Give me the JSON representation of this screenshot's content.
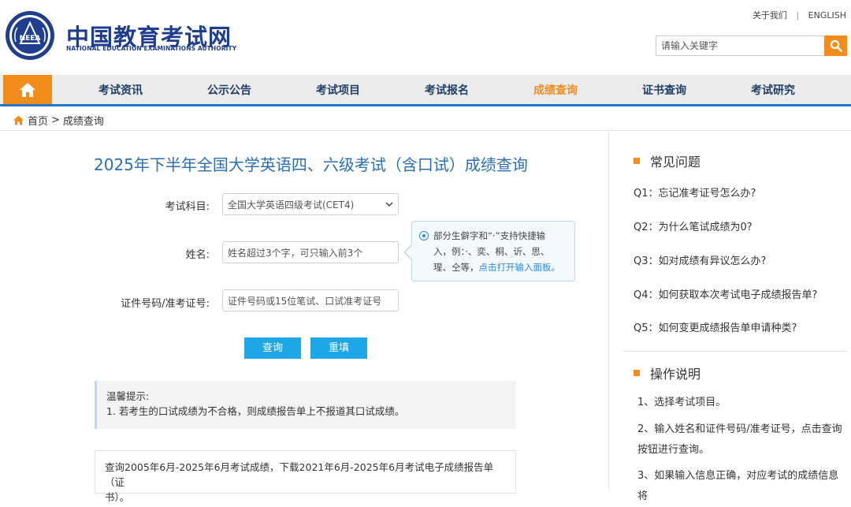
{
  "header": {
    "brand_cn": "中国教育考试网",
    "brand_en": "NATIONAL EDUCATION EXAMINATIONS AUTHORITY",
    "logo_text": "NEEA",
    "about_link": "关于我们",
    "separator": "|",
    "english_link": "ENGLISH",
    "search_placeholder": "请输入关键字"
  },
  "nav": {
    "home_icon": "home-icon",
    "items": [
      "考试资讯",
      "公示公告",
      "考试项目",
      "考试报名",
      "成绩查询",
      "证书查询",
      "考试研究"
    ],
    "active_index": 4
  },
  "breadcrumb": {
    "home": "首页",
    "sep": ">",
    "current": "成绩查询"
  },
  "form": {
    "title": "2025年下半年全国大学英语四、六级考试（含口试）成绩查询",
    "subject_label": "考试科目:",
    "subject_value": "全国大学英语四级考试(CET4)",
    "name_label": "姓名:",
    "name_placeholder": "姓名超过3个字，可只输入前3个",
    "id_label": "证件号码/准考证号:",
    "id_placeholder": "证件号码或15位笔试、口试准考证号",
    "query_btn": "查询",
    "reset_btn": "重填"
  },
  "tip": {
    "line1": "部分生僻字和“·”支持快捷输",
    "line2": "入，例：·、奕、桐、䜣、思、",
    "line3_prefix": "瑆、仝等，",
    "line3_link": "点击打开输入面板。"
  },
  "notice": {
    "title": "温馨提示:",
    "line": "1. 若考生的口试成绩为不合格，则成绩报告单上不报道其口试成绩。"
  },
  "query_box": {
    "line1": "查询2005年6月-2025年6月考试成绩，下载2021年6月-2025年6月考试电子成绩报告单（证",
    "line2": "书）。"
  },
  "sidebar": {
    "faq_title": "常见问题",
    "faq": [
      "Q1：忘记准考证号怎么办?",
      "Q2：为什么笔试成绩为0?",
      "Q3：如对成绩有异议怎么办?",
      "Q4：如何获取本次考试电子成绩报告单?",
      "Q5：如何变更成绩报告单申请种类?"
    ],
    "ops_title": "操作说明",
    "ops": [
      "1、选择考试项目。",
      "2、输入姓名和证件号码/准考证号，点击查询按钮进行查询。",
      "3、如果输入信息正确，对应考试的成绩信息将"
    ]
  },
  "colors": {
    "brand_blue": "#1f3f8e",
    "accent_orange": "#f28c1a",
    "button_blue": "#1ea7e6",
    "title_blue": "#2a6fb0"
  }
}
